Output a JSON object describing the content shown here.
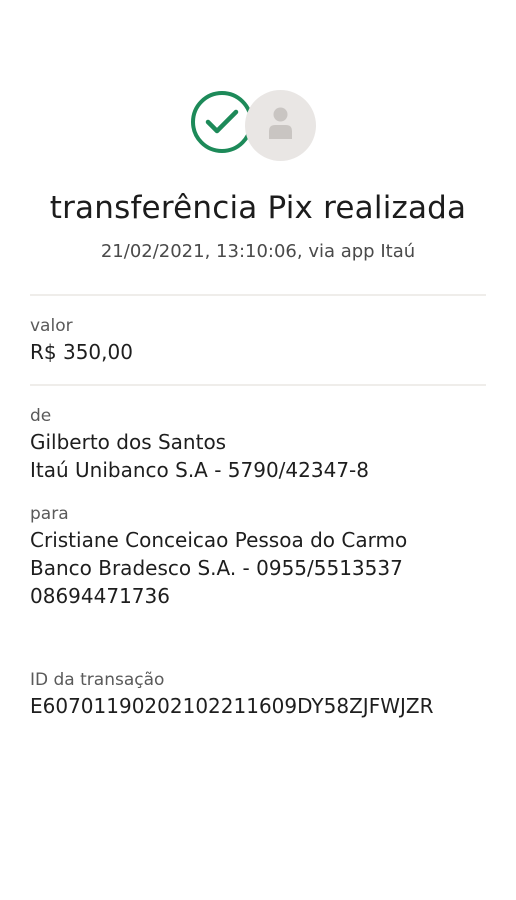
{
  "header": {
    "status_icon": "check-circle-icon",
    "avatar_icon": "user-avatar-icon",
    "title": "transferência Pix realizada",
    "subtitle": "21/02/2021,  13:10:06, via app Itaú",
    "colors": {
      "success": "#1d8a59",
      "avatar_bg": "#e9e6e4"
    }
  },
  "amount": {
    "label": "valor",
    "value": "R$ 350,00"
  },
  "sender": {
    "label": "de",
    "name": "Gilberto dos Santos",
    "bank": "Itaú Unibanco S.A - 5790/42347-8"
  },
  "recipient": {
    "label": "para",
    "name": "Cristiane Conceicao Pessoa do Carmo",
    "bank": "Banco Bradesco S.A. - 0955/5513537",
    "document": "08694471736"
  },
  "transaction": {
    "label": "ID da transação",
    "id": "E60701190202102211609DY58ZJFWJZR"
  }
}
